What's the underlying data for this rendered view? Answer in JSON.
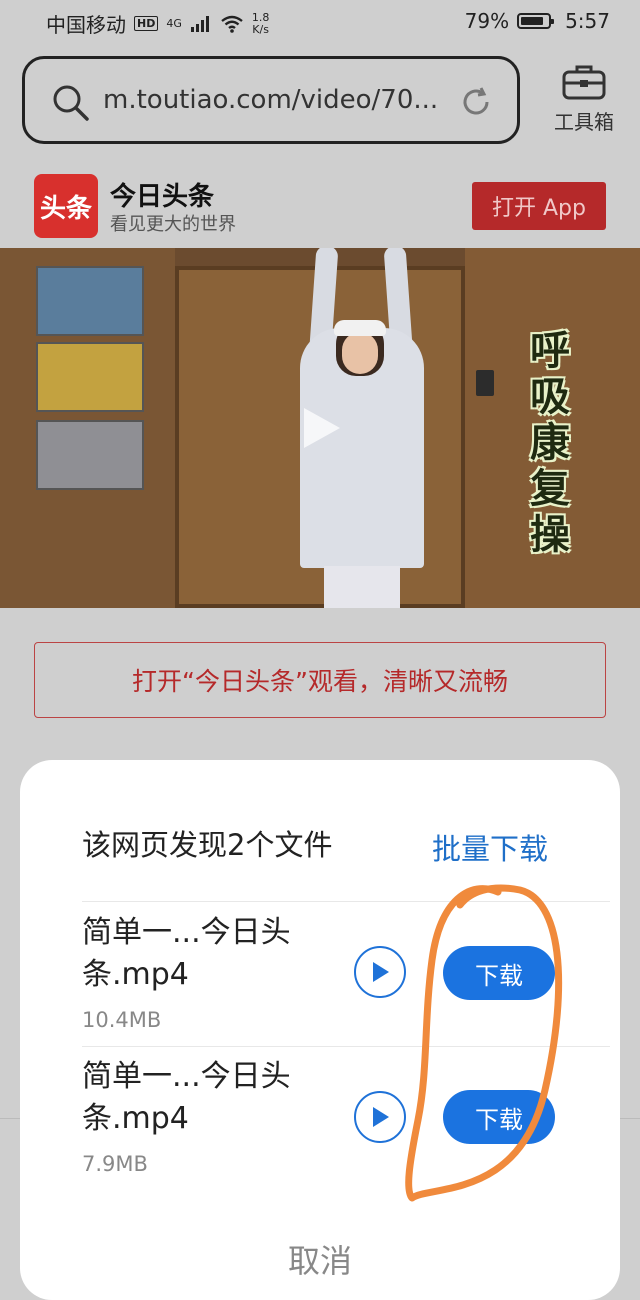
{
  "status_bar": {
    "carrier": "中国移动",
    "hd": "HD",
    "network": "4G",
    "speed_value": "1.8",
    "speed_unit": "K/s",
    "battery": "79%",
    "battery_level": 0.79,
    "time": "5:57"
  },
  "browser": {
    "url": "m.toutiao.com/video/70...",
    "toolbox_label": "工具箱"
  },
  "app_banner": {
    "logo_text": "头条",
    "app_name": "今日头条",
    "slogan": "看见更大的世界",
    "open_button": "打开 App"
  },
  "video": {
    "overlay_title": [
      "呼",
      "吸",
      "康",
      "复",
      "操"
    ]
  },
  "open_watch_bar": "打开“今日头条”观看，清晰又流畅",
  "dialog": {
    "title": "该网页发现2个文件",
    "batch_download": "批量下载",
    "files": [
      {
        "name_line1": "简单一...今日头",
        "name_line2": "条.mp4",
        "size": "10.4MB",
        "download": "下载"
      },
      {
        "name_line1": "简单一...今日头",
        "name_line2": "条.mp4",
        "size": "7.9MB",
        "download": "下载"
      }
    ],
    "cancel": "取消"
  },
  "colors": {
    "accent_blue": "#1b73e0",
    "brand_red": "#d8302d",
    "annotation_orange": "#f08a3c"
  }
}
